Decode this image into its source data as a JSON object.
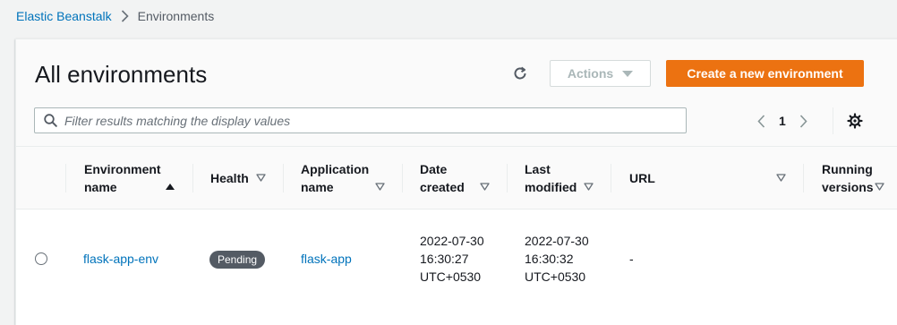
{
  "breadcrumb": {
    "root": "Elastic Beanstalk",
    "current": "Environments"
  },
  "header": {
    "title": "All environments",
    "actions_label": "Actions",
    "create_label": "Create a new environment"
  },
  "search": {
    "placeholder": "Filter results matching the display values"
  },
  "pagination": {
    "current_page": "1"
  },
  "table": {
    "columns": {
      "env_name_line1": "Environment",
      "env_name_line2": "name",
      "health": "Health",
      "app_name_line1": "Application",
      "app_name_line2": "name",
      "date_created_line1": "Date",
      "date_created_line2": "created",
      "last_modified_line1": "Last",
      "last_modified_line2": "modified",
      "url": "URL",
      "running_versions_line1": "Running",
      "running_versions_line2": "versions"
    },
    "rows": [
      {
        "env_name": "flask-app-env",
        "health": "Pending",
        "app_name": "flask-app",
        "date_created_date": "2022-07-30",
        "date_created_time": "16:30:27",
        "date_created_tz": "UTC+0530",
        "last_modified_date": "2022-07-30",
        "last_modified_time": "16:30:32",
        "last_modified_tz": "UTC+0530",
        "url": "-"
      }
    ]
  },
  "colors": {
    "primary_orange": "#ec7211",
    "link_blue": "#0073bb",
    "badge_grey": "#545b64"
  }
}
